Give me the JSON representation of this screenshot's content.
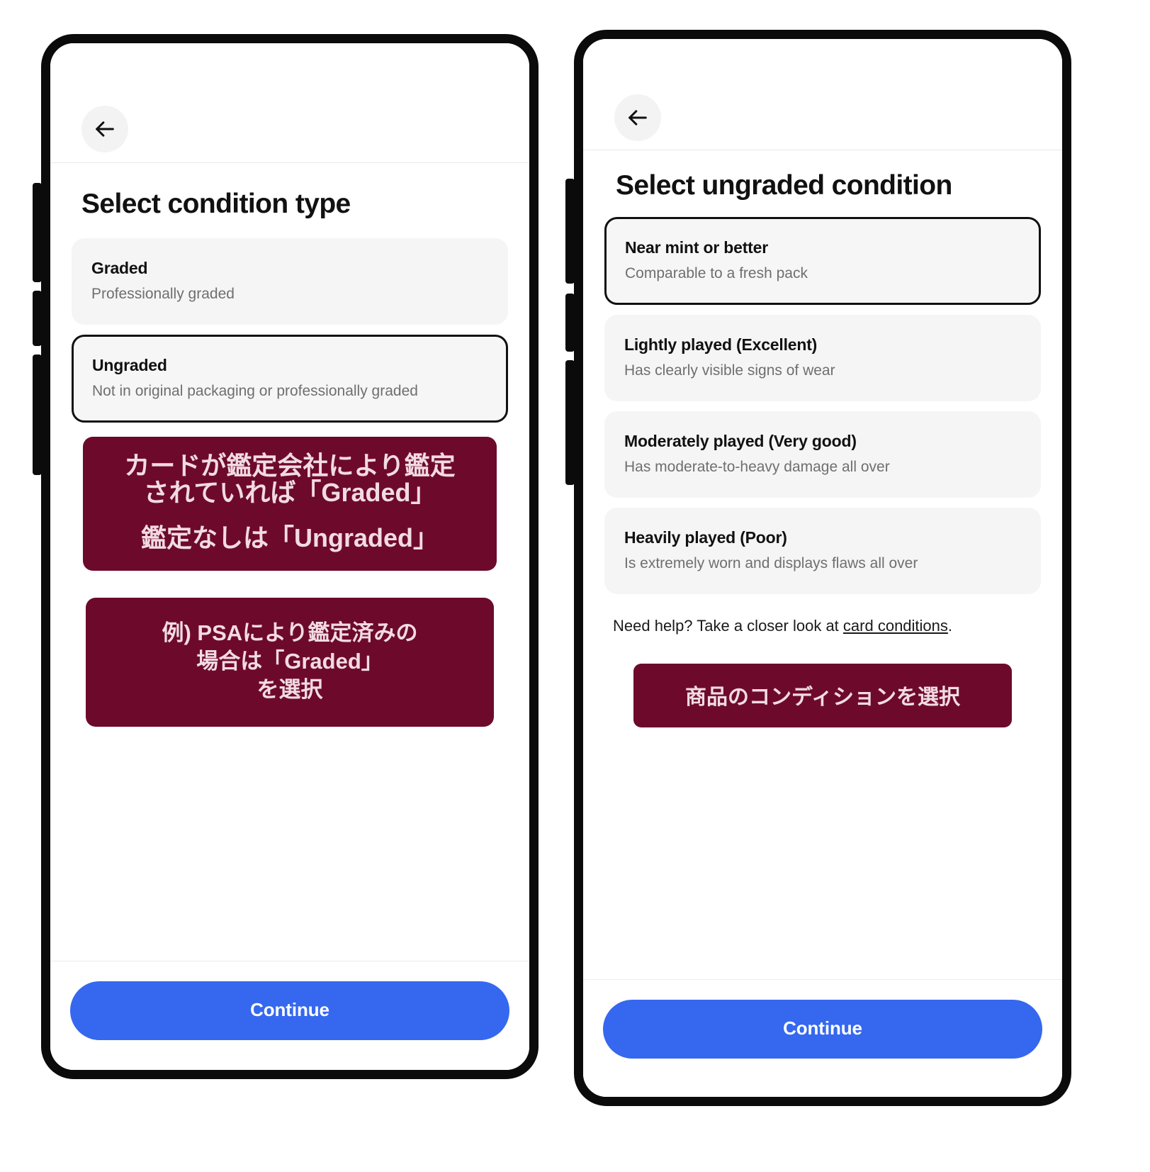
{
  "left_phone": {
    "back_icon": "arrow-left-icon",
    "title": "Select condition type",
    "options": [
      {
        "title": "Graded",
        "subtitle": "Professionally graded",
        "selected": false
      },
      {
        "title": "Ungraded",
        "subtitle": "Not in original packaging or professionally graded",
        "selected": true
      }
    ],
    "callout_1": {
      "line1": "カードが鑑定会社により鑑定",
      "line2": "されていれば「Graded」",
      "line3": "鑑定なしは「Ungraded」"
    },
    "callout_2": {
      "line1": "例) PSAにより鑑定済みの",
      "line2": "場合は「Graded」",
      "line3": "を選択"
    },
    "continue_label": "Continue"
  },
  "right_phone": {
    "back_icon": "arrow-left-icon",
    "title": "Select ungraded condition",
    "options": [
      {
        "title": "Near mint or better",
        "subtitle": "Comparable to a fresh pack",
        "selected": true
      },
      {
        "title": "Lightly played (Excellent)",
        "subtitle": "Has clearly visible signs of wear",
        "selected": false
      },
      {
        "title": "Moderately played (Very good)",
        "subtitle": "Has moderate-to-heavy damage all over",
        "selected": false
      },
      {
        "title": "Heavily played (Poor)",
        "subtitle": "Is extremely worn and displays flaws all over",
        "selected": false
      }
    ],
    "help": {
      "prefix": "Need help? Take a closer look at ",
      "link": "card conditions",
      "suffix": "."
    },
    "cta_label": "商品のコンディションを選択",
    "continue_label": "Continue"
  },
  "colors": {
    "accent_blue": "#3568ef",
    "annotation_maroon": "#6d0a2c",
    "annotation_text": "#f2dbe3",
    "option_bg": "#f5f5f5",
    "selected_border": "#111111"
  }
}
